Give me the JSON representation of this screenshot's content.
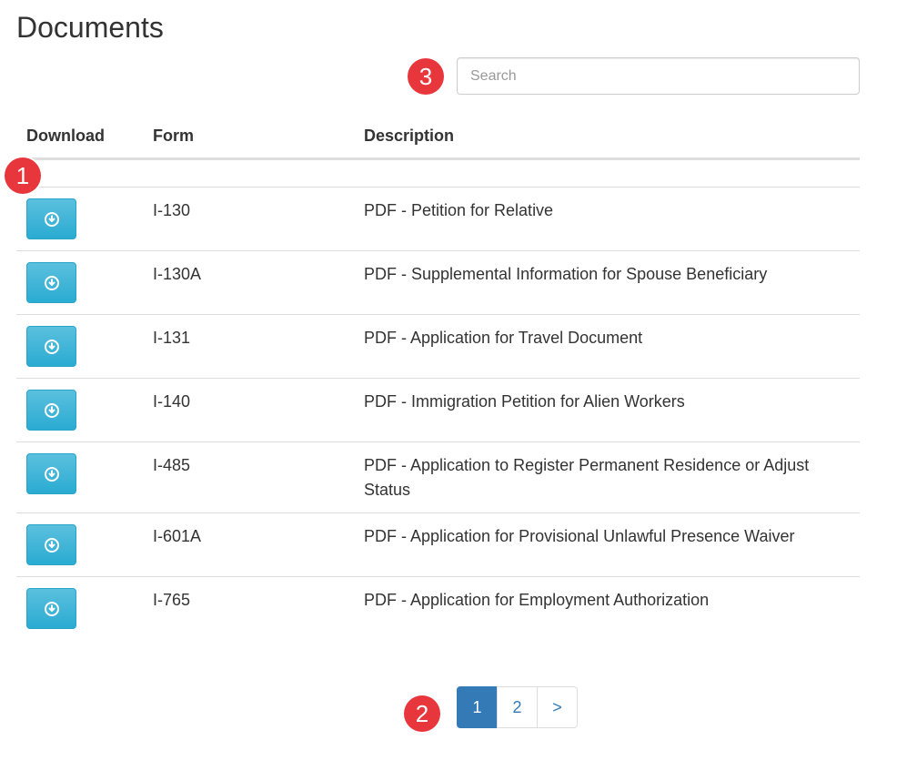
{
  "page_title": "Documents",
  "search": {
    "placeholder": "Search",
    "value": ""
  },
  "annotations": {
    "badge_1": "1",
    "badge_2": "2",
    "badge_3": "3"
  },
  "table": {
    "headers": {
      "download": "Download",
      "form": "Form",
      "description": "Description"
    },
    "rows": [
      {
        "form": "I-130",
        "description": "PDF - Petition for Relative"
      },
      {
        "form": "I-130A",
        "description": "PDF - Supplemental Information for Spouse Beneficiary"
      },
      {
        "form": "I-131",
        "description": "PDF - Application for Travel Document"
      },
      {
        "form": "I-140",
        "description": "PDF - Immigration Petition for Alien Workers"
      },
      {
        "form": "I-485",
        "description": "PDF - Application to Register Permanent Residence or Adjust Status"
      },
      {
        "form": "I-601A",
        "description": "PDF - Application for Provisional Unlawful Presence Waiver"
      },
      {
        "form": "I-765",
        "description": "PDF - Application for Employment Authorization"
      }
    ]
  },
  "pagination": {
    "pages": [
      "1",
      "2"
    ],
    "next": ">",
    "active": "1"
  },
  "colors": {
    "download_button": "#31b0d5",
    "active_page": "#337ab7",
    "badge": "#e8363d"
  },
  "icons": {
    "download": "circle-arrow-down-icon"
  }
}
